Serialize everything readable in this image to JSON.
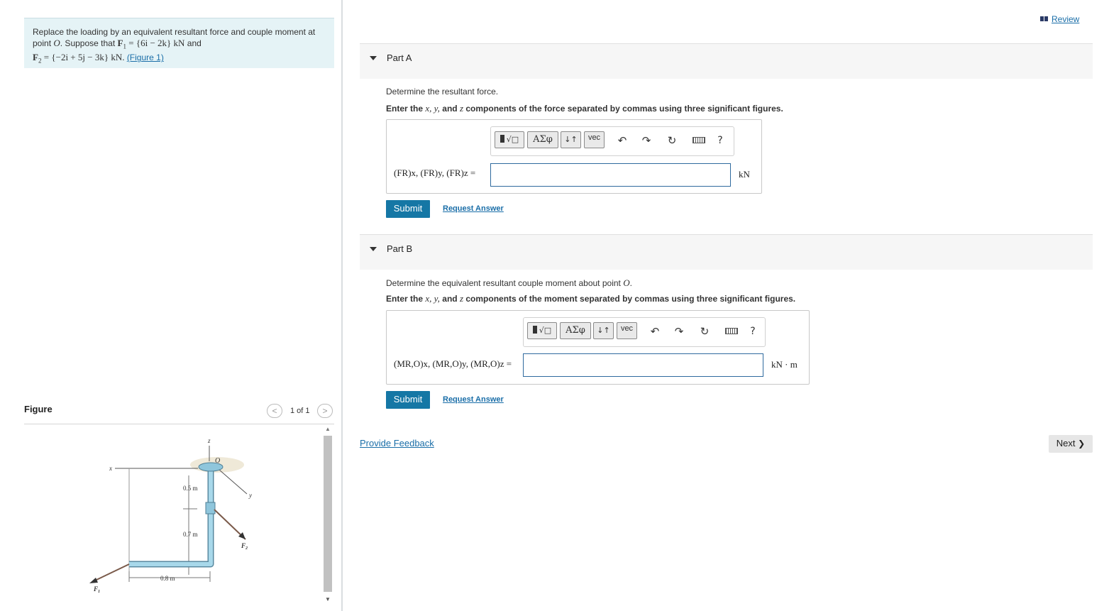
{
  "problem": {
    "intro": "Replace the loading by an equivalent resultant force and couple moment at point",
    "point": "O",
    "suppose": ". Suppose that",
    "f1_label": "F",
    "f1_sub": "1",
    "f1_value": "= {6i − 2k} kN",
    "and": "and",
    "f2_label": "F",
    "f2_sub": "2",
    "f2_value": "= {−2i + 5j − 3k} kN.",
    "figure_link": "(Figure 1)"
  },
  "figure": {
    "title": "Figure",
    "counter": "1 of 1",
    "prev_icon": "chevron-left-icon",
    "next_icon": "chevron-right-icon",
    "labels": {
      "z": "z",
      "x": "x",
      "y": "y",
      "o": "O",
      "d1": "0.5 m",
      "d2": "0.7 m",
      "d3": "0.8 m",
      "f1": "F",
      "f1_sub": "1",
      "f2": "F",
      "f2_sub": "2"
    }
  },
  "review": {
    "label": "Review",
    "icon": "review-icon"
  },
  "partA": {
    "title": "Part A",
    "question": "Determine the resultant force.",
    "instruction_pre": "Enter the",
    "instruction_vars": "x, y,",
    "instruction_and": "and",
    "instruction_z": "z",
    "instruction_post": "components of the force separated by commas using three significant figures.",
    "answer_label": "(FR)x, (FR)y, (FR)z =",
    "answer_value": "",
    "unit": "kN",
    "submit": "Submit",
    "request": "Request Answer"
  },
  "partB": {
    "title": "Part B",
    "question_pre": "Determine the equivalent resultant couple moment about point",
    "question_point": "O",
    "question_end": ".",
    "instruction_pre": "Enter the",
    "instruction_vars": "x, y,",
    "instruction_and": "and",
    "instruction_z": "z",
    "instruction_post": "components of the moment separated by commas using three significant figures.",
    "answer_label": "(MR,O)x, (MR,O)y, (MR,O)z =",
    "answer_value": "",
    "unit": "kN · m",
    "submit": "Submit",
    "request": "Request Answer"
  },
  "toolbar": {
    "template": "√□",
    "greek": "ΑΣφ",
    "arrows": "↓↑",
    "vec": "vec",
    "undo": "↶",
    "redo": "↷",
    "reset": "↻",
    "help": "?"
  },
  "feedback": "Provide Feedback",
  "next": "Next",
  "next_chevron": "❯",
  "colors": {
    "accent": "#1577a5",
    "link": "#1a6ea8",
    "problem_bg": "#e5f3f6",
    "pipe": "#a8d8ea"
  }
}
